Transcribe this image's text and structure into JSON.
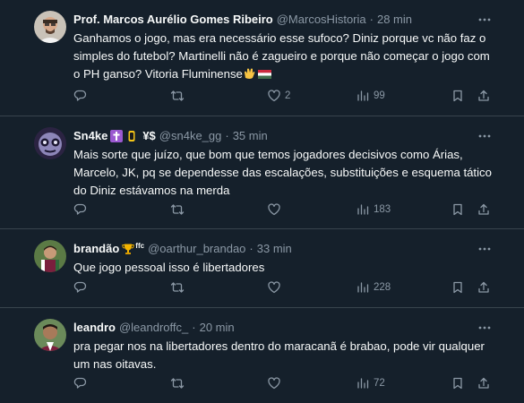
{
  "colors": {
    "background": "#15202b",
    "divider": "#38444d",
    "text_primary": "#f7f9f9",
    "text_secondary": "#8b98a5"
  },
  "tweets": [
    {
      "name": "Prof. Marcos Aurélio Gomes Ribeiro",
      "handle": "@MarcosHistoria",
      "time": "28 min",
      "text": "Ganhamos o jogo, mas era necessário esse sufoco? Diniz porque vc não faz o simples do futebol? Martinelli não é zagueiro e porque não começar o jogo com o PH ganso? Vitoria Fluminense",
      "text_emojis": [
        "clapping-hands-emoji",
        "hungary-flag-emoji"
      ],
      "reply_count": "",
      "retweet_count": "",
      "like_count": "2",
      "view_count": "99"
    },
    {
      "name": "Sn4ke",
      "name_emojis": [
        "latin-cross-emoji",
        "vertical-traffic-light-emoji"
      ],
      "name_suffix": "¥$",
      "handle": "@sn4ke_gg",
      "time": "35 min",
      "text": "Mais sorte que juízo, que bom que temos jogadores decisivos como Árias, Marcelo, JK, pq se dependesse das escalações, substituições e esquema tático do Diniz estávamos na merda",
      "reply_count": "",
      "retweet_count": "",
      "like_count": "",
      "view_count": "183"
    },
    {
      "name": "brandão",
      "name_emojis": [
        "trophy-emoji",
        "ffc-badge"
      ],
      "handle": "@oarthur_brandao",
      "time": "33 min",
      "text": "Que jogo pessoal isso é libertadores",
      "reply_count": "",
      "retweet_count": "",
      "like_count": "",
      "view_count": "228"
    },
    {
      "name": "leandro",
      "handle": "@leandroffc_",
      "time": "20 min",
      "text": "pra pegar nos na libertadores dentro do maracanã é brabao, pode vir qualquer um nas oitavas.",
      "reply_count": "",
      "retweet_count": "",
      "like_count": "",
      "view_count": "72"
    }
  ],
  "ui": {
    "separator": "·",
    "ffc_badge_text": "ffc"
  }
}
